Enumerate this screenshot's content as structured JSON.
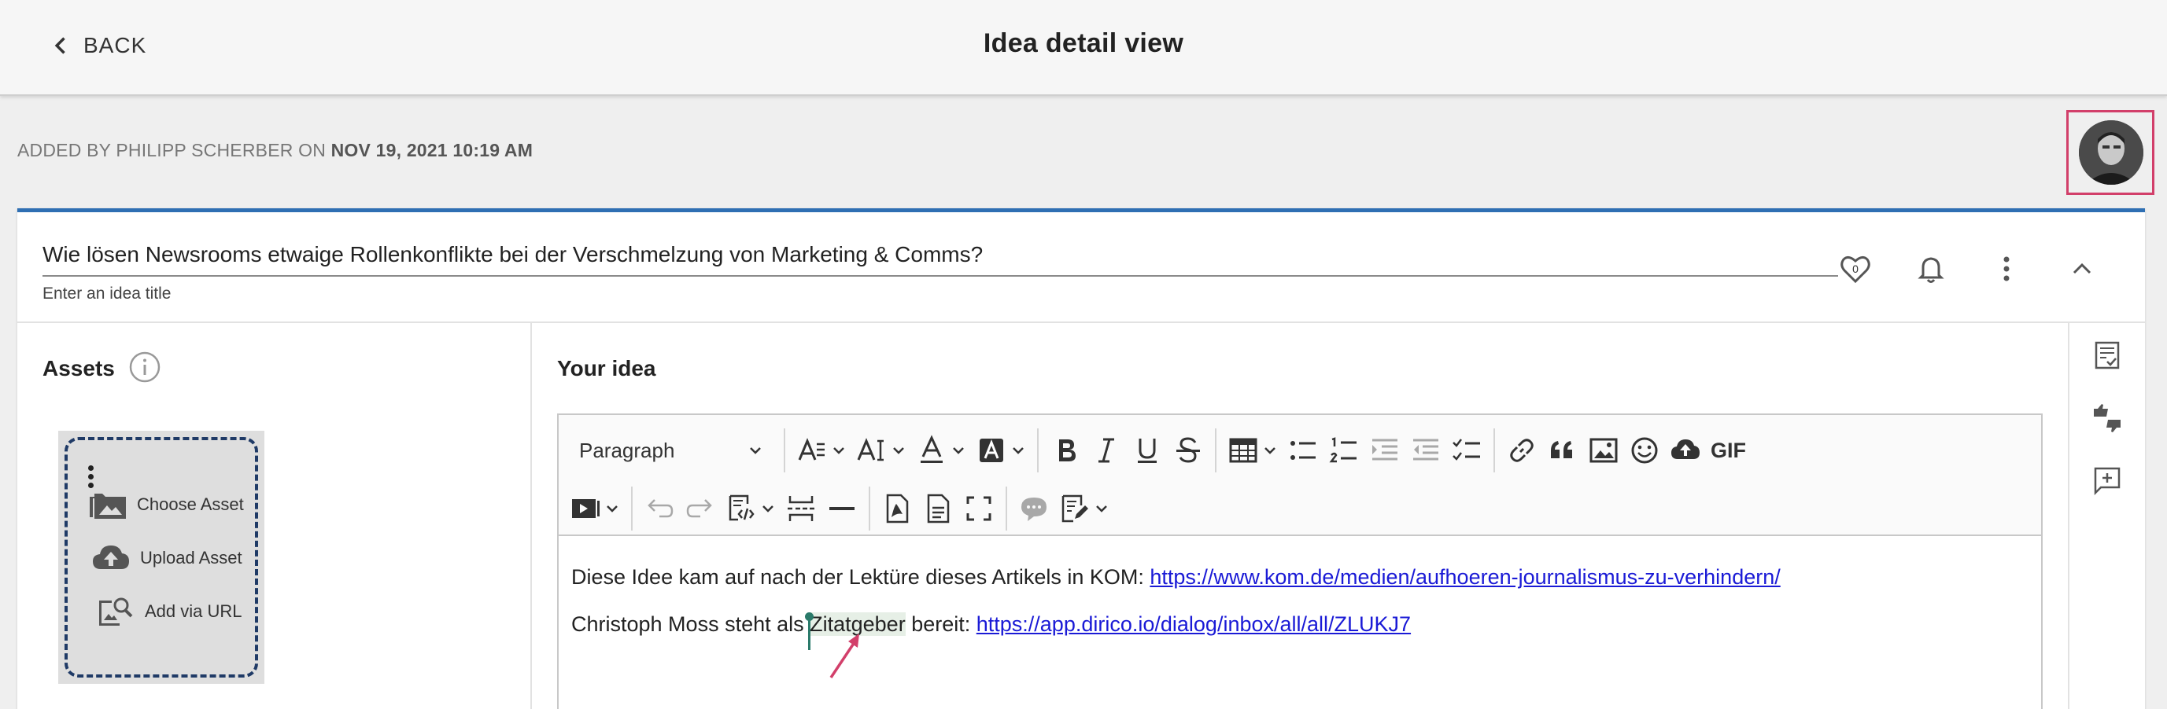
{
  "header": {
    "back_label": "BACK",
    "title": "Idea detail view"
  },
  "meta": {
    "prefix": "ADDED BY PHILIPP SCHERBER ON",
    "date": "NOV 19, 2021 10:19 AM"
  },
  "idea": {
    "title_value": "Wie lösen Newsrooms etwaige Rollenkonflikte bei der Verschmelzung von Marketing & Comms?",
    "title_hint": "Enter an idea title",
    "likes_count": "0"
  },
  "assets": {
    "label": "Assets",
    "actions": {
      "choose": "Choose Asset",
      "upload": "Upload Asset",
      "url": "Add via URL"
    }
  },
  "editor": {
    "label": "Your idea",
    "paragraph_select": "Paragraph",
    "gif_label": "GIF",
    "line1_text": "Diese Idee kam auf nach der Lektüre dieses Artikels in KOM: ",
    "line1_link": "https://www.kom.de/medien/aufhoeren-journalismus-zu-verhindern/",
    "line2_text_a": "Christoph Moss steht als ",
    "line2_highlight": "Zitatgeber",
    "line2_text_b": " bereit: ",
    "line2_link": "https://app.dirico.io/dialog/inbox/all/all/ZLUKJ7"
  },
  "colors": {
    "accent_blue": "#2f6fb3",
    "highlight_frame": "#d23f6a",
    "link": "#1a1ad6",
    "cursor": "#2a7a6a"
  }
}
